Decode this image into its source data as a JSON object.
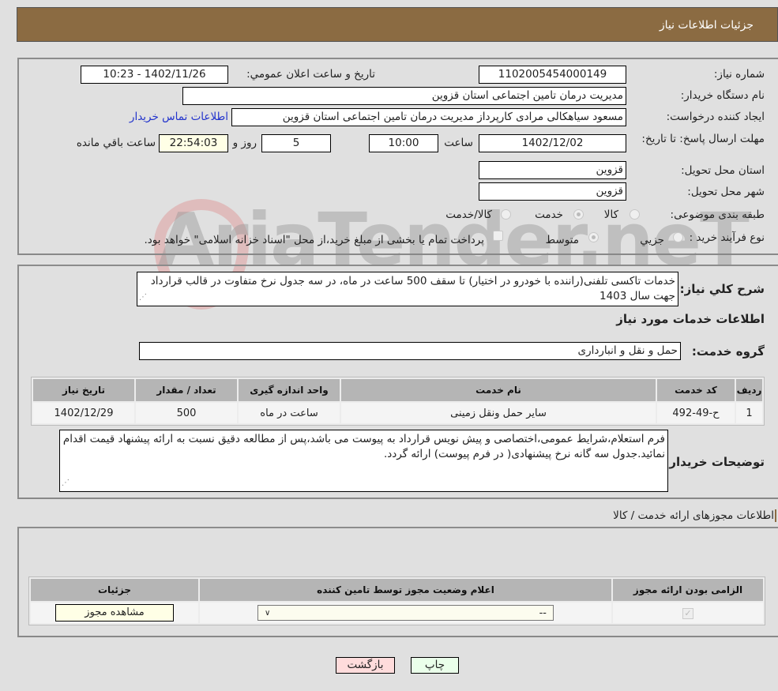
{
  "header": {
    "title": "جزئیات اطلاعات نیاز"
  },
  "form": {
    "need_number_label": "شماره نیاز:",
    "need_number": "1102005454000149",
    "announce_label": "تاریخ و ساعت اعلان عمومي:",
    "announce_value": "1402/11/26 - 10:23",
    "buyer_org_label": "نام دستگاه خریدار:",
    "buyer_org": "مدیریت درمان تامین اجتماعی استان قزوین",
    "creator_label": "ایجاد کننده درخواست:",
    "creator": "مسعود سیاهکالی مرادی کارپرداز مدیریت درمان تامین اجتماعی استان قزوین",
    "contact_link": "اطلاعات تماس خریدار",
    "deadline_label": "مهلت ارسال پاسخ: تا تاریخ:",
    "deadline_date": "1402/12/02",
    "time_label": "ساعت",
    "deadline_time": "10:00",
    "days": "5",
    "days_label": "روز و",
    "remaining": "22:54:03",
    "remaining_label": "ساعت باقي مانده",
    "province_label": "استان محل تحویل:",
    "province": "قزوین",
    "city_label": "شهر محل تحویل:",
    "city": "قزوین",
    "category_label": "طبقه بندی موضوعی:",
    "category_options": [
      "کالا",
      "خدمت",
      "کالا/خدمت"
    ],
    "category_selected": "خدمت",
    "process_label": "نوع فرآیند خرید :",
    "process_options": [
      "جزيي",
      "متوسط"
    ],
    "process_selected": "متوسط",
    "treasury_note": "پرداخت تمام یا بخشی از مبلغ خرید،از محل \"اسناد خزانه اسلامی\" خواهد بود."
  },
  "description": {
    "label": "شرح کلي نیاز:",
    "text": "خدمات تاکسی تلفنی(راننده با خودرو در اختیار) تا سقف 500 ساعت در ماه، در سه جدول نرخ متفاوت در قالب قرارداد جهت سال 1403"
  },
  "services": {
    "title": "اطلاعات خدمات مورد نیاز",
    "group_label": "گروه خدمت:",
    "group": "حمل و نقل و انبارداری",
    "columns": [
      "ردیف",
      "کد خدمت",
      "نام خدمت",
      "واحد اندازه گیری",
      "تعداد / مقدار",
      "تاریخ نیاز"
    ],
    "rows": [
      [
        "1",
        "ح-49-492",
        "سایر حمل ونقل زمینی",
        "ساعت در ماه",
        "500",
        "1402/12/29"
      ]
    ]
  },
  "buyer_notes": {
    "label": "توضیحات خریدار:",
    "text": "فرم استعلام،شرایط عمومی،اختصاصی و پیش نویس قرارداد به پیوست می باشد،پس از مطالعه دقیق نسبت به ارائه پیشنهاد قیمت اقدام نمائید.جدول سه گانه نرخ پیشنهادی( در فرم پیوست) ارائه گردد."
  },
  "permits": {
    "title": "اطلاعات مجوزهای ارائه خدمت / کالا",
    "columns": [
      "الزامی بودن ارائه مجوز",
      "اعلام وضعیت مجوز توسط تامین کننده",
      "جزئیات"
    ],
    "select_value": "--",
    "view_button": "مشاهده مجوز"
  },
  "buttons": {
    "print": "چاپ",
    "back": "بازگشت"
  },
  "watermark": "AriaTender.neT"
}
